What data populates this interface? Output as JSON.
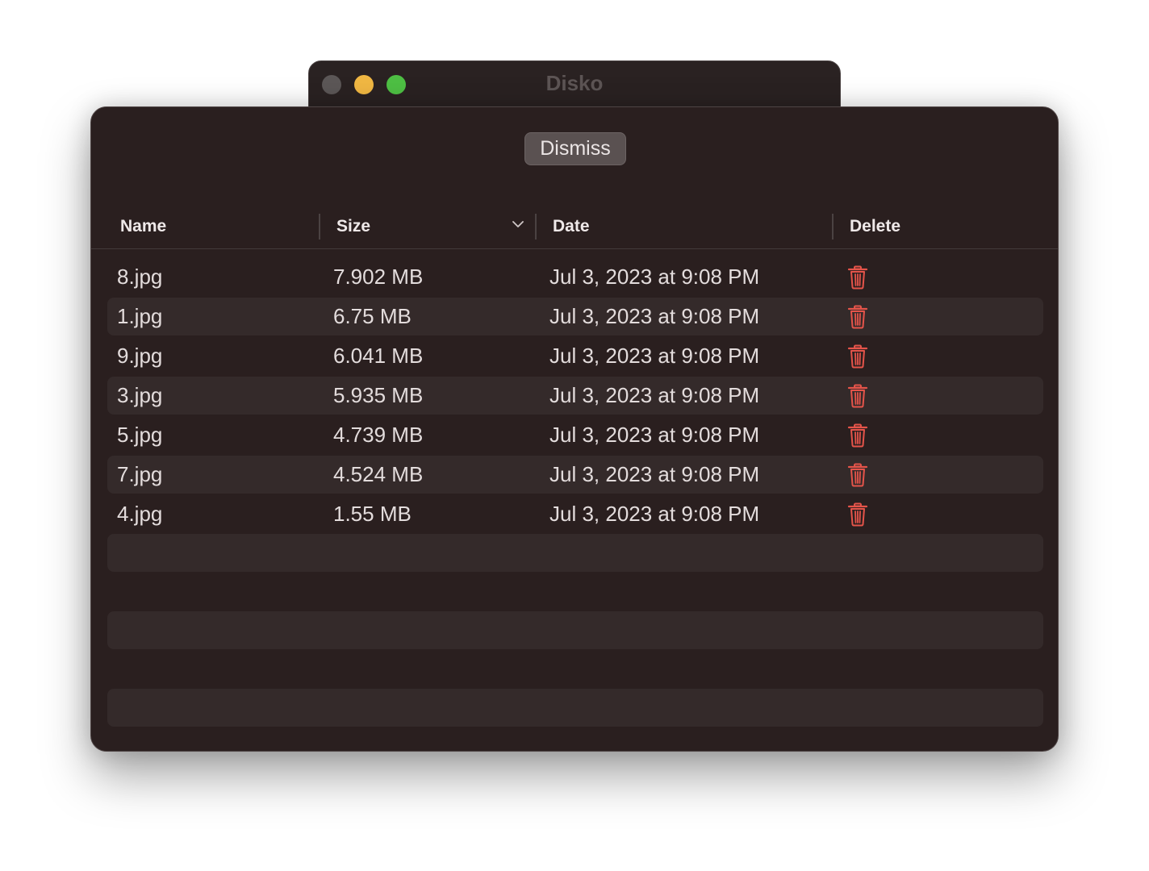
{
  "window": {
    "title": "Disko"
  },
  "sheet": {
    "dismiss_label": "Dismiss"
  },
  "table": {
    "columns": [
      {
        "key": "name",
        "label": "Name"
      },
      {
        "key": "size",
        "label": "Size",
        "sorted": "descending"
      },
      {
        "key": "date",
        "label": "Date"
      },
      {
        "key": "delete",
        "label": "Delete"
      }
    ],
    "rows": [
      {
        "name": "8.jpg",
        "size": "7.902 MB",
        "date": "Jul 3, 2023 at 9:08 PM"
      },
      {
        "name": "1.jpg",
        "size": "6.75 MB",
        "date": "Jul 3, 2023 at 9:08 PM"
      },
      {
        "name": "9.jpg",
        "size": "6.041 MB",
        "date": "Jul 3, 2023 at 9:08 PM"
      },
      {
        "name": "3.jpg",
        "size": "5.935 MB",
        "date": "Jul 3, 2023 at 9:08 PM"
      },
      {
        "name": "5.jpg",
        "size": "4.739 MB",
        "date": "Jul 3, 2023 at 9:08 PM"
      },
      {
        "name": "7.jpg",
        "size": "4.524 MB",
        "date": "Jul 3, 2023 at 9:08 PM"
      },
      {
        "name": "4.jpg",
        "size": "1.55 MB",
        "date": "Jul 3, 2023 at 9:08 PM"
      }
    ],
    "delete_icon": "trash-icon",
    "delete_icon_color": "#e5544a"
  },
  "colors": {
    "sheet_background": "#2a1f1f",
    "alternate_row": "#342a2a",
    "close_button": "#5c5757",
    "minimize_button": "#f0b743",
    "zoom_button": "#4ebf44"
  }
}
